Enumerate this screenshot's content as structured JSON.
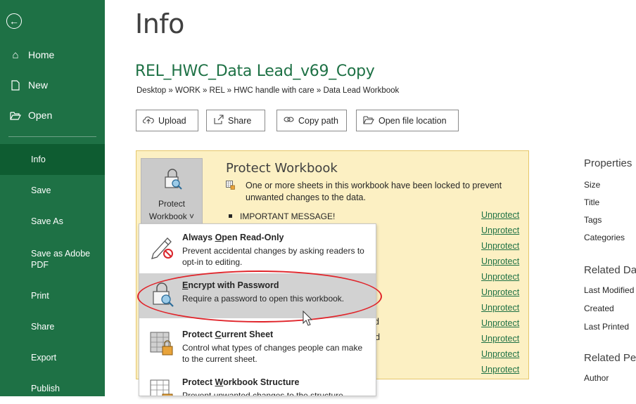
{
  "sidebar": {
    "back_icon": "back-arrow-icon",
    "top": [
      {
        "label": "Home",
        "icon": "home-icon"
      },
      {
        "label": "New",
        "icon": "new-document-icon"
      },
      {
        "label": "Open",
        "icon": "folder-open-icon"
      }
    ],
    "items": [
      {
        "label": "Info",
        "active": true
      },
      {
        "label": "Save"
      },
      {
        "label": "Save As"
      },
      {
        "label": "Save as Adobe\nPDF"
      },
      {
        "label": "Print"
      },
      {
        "label": "Share"
      },
      {
        "label": "Export"
      },
      {
        "label": "Publish"
      }
    ]
  },
  "page": {
    "title": "Info",
    "file_name": "REL_HWC_Data Lead_v69_Copy",
    "breadcrumb": "Desktop » WORK » REL » HWC handle with care » Data Lead Workbook"
  },
  "actions": [
    {
      "label": "Upload",
      "icon": "upload-cloud-icon"
    },
    {
      "label": "Share",
      "icon": "share-icon"
    },
    {
      "label": "Copy path",
      "icon": "link-icon"
    },
    {
      "label": "Open file location",
      "icon": "folder-open-icon"
    }
  ],
  "protect": {
    "button_line1": "Protect",
    "button_line2": "Workbook ˅",
    "title": "Protect Workbook",
    "description": "One or more sheets in this workbook have been locked to prevent unwanted changes to the data.",
    "bullet": "IMPORTANT MESSAGE!",
    "unprotect_label": "Unprotect",
    "unprotect_count": 11,
    "partial_texts": [
      "d",
      "rd"
    ]
  },
  "dropdown": {
    "items": [
      {
        "title": "Always Open Read-Only",
        "desc": "Prevent accidental changes by asking readers to opt-in to editing.",
        "icon": "pencil-no-edit-icon"
      },
      {
        "title": "Encrypt with Password",
        "desc": "Require a password to open this workbook.",
        "icon": "lock-key-icon",
        "highlighted": true
      },
      {
        "title": "Protect Current Sheet",
        "desc": "Control what types of changes people can make to the current sheet.",
        "icon": "sheet-lock-icon"
      },
      {
        "title": "Protect Workbook Structure",
        "desc": "Prevent unwanted changes to the structure",
        "icon": "workbook-lock-icon"
      }
    ]
  },
  "properties": {
    "heading": "Properties",
    "fields": [
      "Size",
      "Title",
      "Tags",
      "Categories"
    ],
    "related_dates_heading": "Related Da",
    "date_fields": [
      "Last Modified",
      "Created",
      "Last Printed"
    ],
    "related_people_heading": "Related Pe",
    "people_fields": [
      "Author"
    ]
  },
  "colors": {
    "sidebar": "#1e7145",
    "sidebar_active": "#0e5c31",
    "panel_bg": "#fcf0c3",
    "link": "#1e7145",
    "annotation": "#e0242a"
  }
}
